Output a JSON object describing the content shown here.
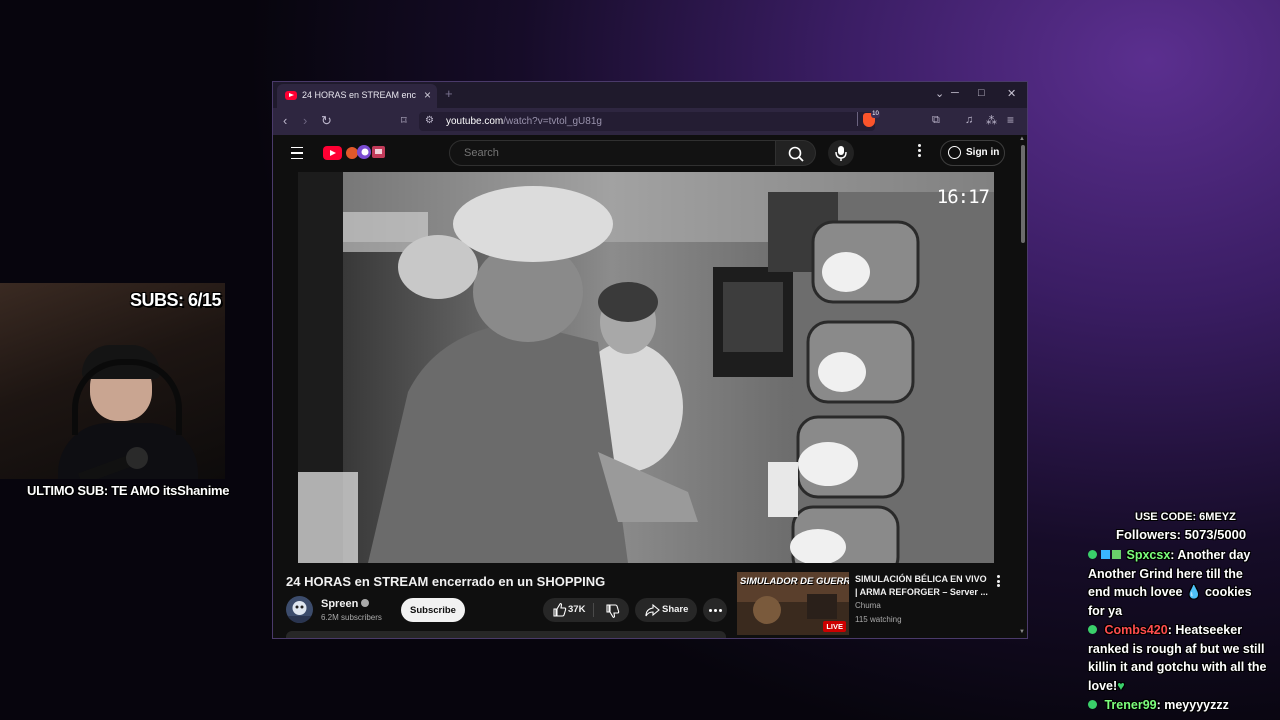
{
  "overlay": {
    "subs_counter": "SUBS: 6/15",
    "last_sub": "ULTIMO SUB: TE AMO itsShanime",
    "use_code": "USE CODE: 6MEYZ",
    "followers": "Followers: 5073/5000"
  },
  "browser": {
    "tab_title": "24 HORAS en STREAM encerrado en un SHOPPING",
    "tab_close": "×",
    "new_tab": "+",
    "url_domain": "youtube.com",
    "url_path": "/watch?v=tvtol_gU81g",
    "brave_badge": "10"
  },
  "youtube": {
    "search_placeholder": "Search",
    "sign_in": "Sign in",
    "video_time_overlay": "16:17",
    "video_title": "24 HORAS en STREAM encerrado en un SHOPPING",
    "channel_name": "Spreen",
    "subscriber_count": "6.2M subscribers",
    "subscribe_label": "Subscribe",
    "like_count": "37K",
    "share_label": "Share",
    "recommended": {
      "thumb_title": "SIMULADOR DE GUERRA",
      "live_badge": "LIVE",
      "title": "SIMULACIÓN BÉLICA EN VIVO | ARMA REFORGER – Server ...",
      "channel": "Chuma",
      "watching": "115 watching"
    }
  },
  "chat": [
    {
      "user": "Spxcsx",
      "color": "#7CFF7C",
      "message": ": Another day Another Grind here till the end much lovee 💧 cookies for ya"
    },
    {
      "user": "Combs420",
      "color": "#FF4D4D",
      "message": ": Heatseeker ranked is rough af but we still killin it and gotchu with all the love!"
    },
    {
      "user": "Trener99",
      "color": "#7CFF7C",
      "message": ": meyyyyzzz"
    }
  ],
  "colors": {
    "yt_red": "#ff0033",
    "browser_chrome": "#2e2640",
    "background_purple": "#5b2f8f"
  }
}
